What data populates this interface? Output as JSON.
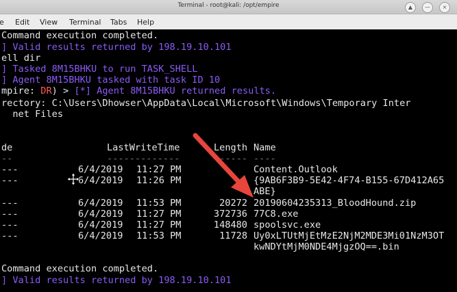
{
  "window": {
    "title": "Terminal - root@kali: /opt/empire",
    "buttons": {
      "up": "▲",
      "minimize": "—",
      "close": "×"
    }
  },
  "menu": [
    "e",
    "Edit",
    "View",
    "Terminal",
    "Tabs",
    "Help"
  ],
  "terminal": {
    "lines": [
      {
        "text": "Command execution completed.",
        "color": "white"
      },
      {
        "text": "] Valid results returned by 198.19.10.101",
        "color": "purple"
      },
      {
        "text": "ell dir",
        "color": "white"
      },
      {
        "text": "] Tasked 8M15BHKU to run TASK_SHELL",
        "color": "purple"
      },
      {
        "text": "] Agent 8M15BHKU tasked with task ID 10",
        "color": "purple"
      }
    ],
    "prompt": {
      "prefix": "mpire: ",
      "agent": "DR",
      "suffix": ") > ",
      "message": "[*] Agent 8M15BHKU returned results."
    },
    "directory_line1": "rectory: C:\\Users\\Dhowser\\AppData\\Local\\Microsoft\\Windows\\Temporary Inter",
    "directory_line2": "  net Files",
    "headers": {
      "mode": "de",
      "lastwrite": "LastWriteTime",
      "length": "Length",
      "name": "Name"
    },
    "separators": {
      "mode": "--",
      "lastwrite": "-------------",
      "length": "------",
      "name": "----"
    },
    "rows": [
      {
        "mode": "---",
        "date": "6/4/2019",
        "time": "11:27 PM",
        "length": "",
        "name": "Content.Outlook"
      },
      {
        "mode": "---",
        "date": "6/4/2019",
        "time": "11:26 PM",
        "length": "",
        "name": "{9AB6F3B9-5E42-4F74-B155-67D412A65",
        "name2": "ABE}"
      },
      {
        "mode": "---",
        "date": "6/4/2019",
        "time": "11:53 PM",
        "length": "20272",
        "name": "20190604235313_BloodHound.zip"
      },
      {
        "mode": "---",
        "date": "6/4/2019",
        "time": "11:27 PM",
        "length": "372736",
        "name": "77C8.exe"
      },
      {
        "mode": "---",
        "date": "6/4/2019",
        "time": "11:27 PM",
        "length": "148480",
        "name": "spoolsvc.exe"
      },
      {
        "mode": "---",
        "date": "6/4/2019",
        "time": "11:53 PM",
        "length": "11728",
        "name": "Uy0xLTUtMjEtMzE2NjM2MDE3Mi01NzM3OT",
        "name2": "kwNDYtMjM0NDE4MjgzOQ==.bin"
      }
    ],
    "footer": [
      {
        "text": "Command execution completed.",
        "color": "white"
      },
      {
        "text": "] Valid results returned by 198.19.10.101",
        "color": "purple"
      }
    ]
  },
  "colors": {
    "purple": "#8a5cf6",
    "red_prompt": "#ff5b5b",
    "arrow": "#e8453c"
  }
}
